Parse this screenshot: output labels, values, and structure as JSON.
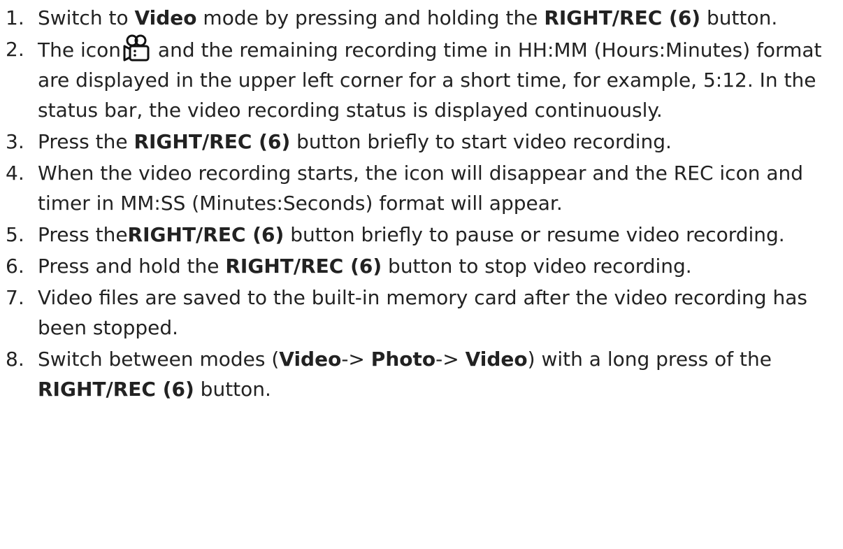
{
  "steps": [
    {
      "num": "1.",
      "parts": [
        "Switch to ",
        "Video",
        " mode by pressing and holding the ",
        "RIGHT/REC (6)",
        " button."
      ]
    },
    {
      "num": "2.",
      "parts": [
        "The icon",
        " and the remaining recording time in HH:MM (Hours:Minutes) format are displayed in the upper left corner for a short time, for example, 5:12. In the status bar, the video recording status is displayed continuously."
      ],
      "icon": "video-camera-icon"
    },
    {
      "num": "3.",
      "parts": [
        "Press the ",
        "RIGHT/REC (6)",
        " button briefly to start video recording."
      ]
    },
    {
      "num": "4.",
      "parts": [
        "When the video recording starts, the icon will disappear and the REC icon and timer in MM:SS (Minutes:Seconds) format will appear."
      ]
    },
    {
      "num": "5.",
      "parts": [
        "Press the",
        "RIGHT/REC (6)",
        " button briefly to pause or resume video recording."
      ]
    },
    {
      "num": "6.",
      "parts": [
        "Press and hold the ",
        "RIGHT/REC (6)",
        " button to stop video recording."
      ]
    },
    {
      "num": "7.",
      "parts": [
        "Video files are saved to the built-in memory card after the video recording has been stopped."
      ]
    },
    {
      "num": "8.",
      "parts": [
        "Switch between modes (",
        "Video",
        "-> ",
        "Photo",
        "-> ",
        "Video",
        ") with a long press of the ",
        "RIGHT/REC (6)",
        " button."
      ]
    }
  ]
}
